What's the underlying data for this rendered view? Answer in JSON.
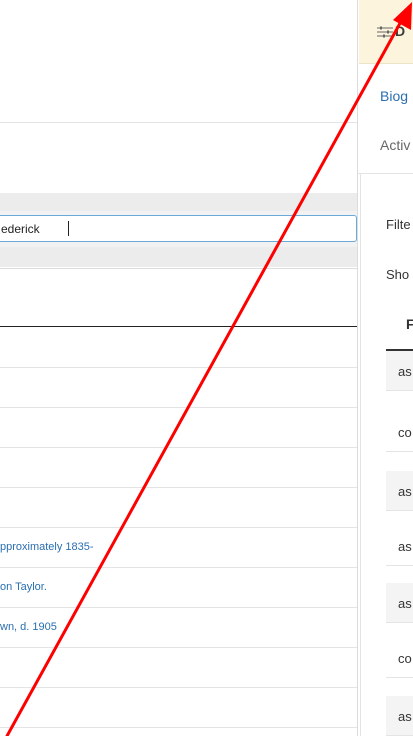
{
  "search": {
    "value": "ederick"
  },
  "results": [
    {
      "text": ""
    },
    {
      "text": ""
    },
    {
      "text": ""
    },
    {
      "text": ""
    },
    {
      "text": ""
    },
    {
      "text": "pproximately 1835-"
    },
    {
      "text": "on Taylor."
    },
    {
      "text": "wn, d. 1905"
    },
    {
      "text": ""
    },
    {
      "text": ""
    }
  ],
  "facet_panel": {
    "chip_label": "D",
    "chip_icon": "sliders-icon",
    "tab_biog": "Biog",
    "tab_activ": "Activ",
    "filter_label": "Filte",
    "show_label": "Sho",
    "column_header": "F",
    "rows": [
      "as",
      "co",
      "as",
      "as",
      "as",
      "co",
      "as"
    ]
  },
  "colors": {
    "link": "#2a6fb0",
    "chip_bg": "#fcf4dc",
    "input_border": "#6aa9d8",
    "arrow": "#ff0000"
  }
}
